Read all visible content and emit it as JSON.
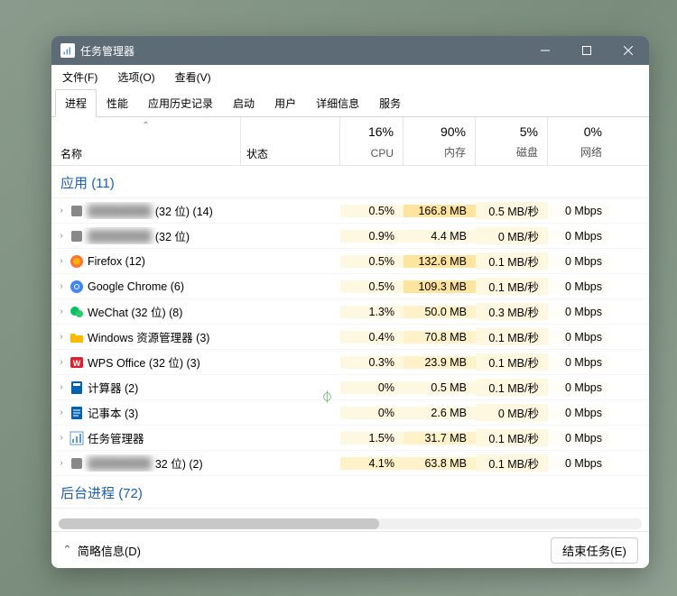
{
  "window": {
    "title": "任务管理器"
  },
  "menubar": {
    "file": "文件(F)",
    "options": "选项(O)",
    "view": "查看(V)"
  },
  "tabs": {
    "items": [
      {
        "label": "进程",
        "active": true
      },
      {
        "label": "性能",
        "active": false
      },
      {
        "label": "应用历史记录",
        "active": false
      },
      {
        "label": "启动",
        "active": false
      },
      {
        "label": "用户",
        "active": false
      },
      {
        "label": "详细信息",
        "active": false
      },
      {
        "label": "服务",
        "active": false
      }
    ]
  },
  "columns": {
    "name": "名称",
    "status": "状态",
    "cpu": {
      "pct": "16%",
      "label": "CPU"
    },
    "memory": {
      "pct": "90%",
      "label": "内存"
    },
    "disk": {
      "pct": "5%",
      "label": "磁盘"
    },
    "network": {
      "pct": "0%",
      "label": "网络"
    }
  },
  "groups": {
    "apps": {
      "label": "应用",
      "count_text": "(11)"
    },
    "bg": {
      "label": "后台进程",
      "count_text": "(72)"
    }
  },
  "rows": [
    {
      "name": "",
      "suffix": "(32 位) (14)",
      "blurred": true,
      "icon": "generic",
      "cpu": "0.5%",
      "mem": "166.8 MB",
      "disk": "0.5 MB/秒",
      "net": "0 Mbps",
      "mem_heat": 3
    },
    {
      "name": "",
      "suffix": "(32 位)",
      "blurred": true,
      "icon": "generic",
      "cpu": "0.9%",
      "mem": "4.4 MB",
      "disk": "0 MB/秒",
      "net": "0 Mbps",
      "mem_heat": 1
    },
    {
      "name": "Firefox (12)",
      "suffix": "",
      "blurred": false,
      "icon": "firefox",
      "cpu": "0.5%",
      "mem": "132.6 MB",
      "disk": "0.1 MB/秒",
      "net": "0 Mbps",
      "mem_heat": 3
    },
    {
      "name": "Google Chrome (6)",
      "suffix": "",
      "blurred": false,
      "icon": "chrome",
      "cpu": "0.5%",
      "mem": "109.3 MB",
      "disk": "0.1 MB/秒",
      "net": "0 Mbps",
      "mem_heat": 3
    },
    {
      "name": "WeChat (32 位) (8)",
      "suffix": "",
      "blurred": false,
      "icon": "wechat",
      "cpu": "1.3%",
      "mem": "50.0 MB",
      "disk": "0.3 MB/秒",
      "net": "0 Mbps",
      "mem_heat": 2
    },
    {
      "name": "Windows 资源管理器 (3)",
      "suffix": "",
      "blurred": false,
      "icon": "explorer",
      "cpu": "0.4%",
      "mem": "70.8 MB",
      "disk": "0.1 MB/秒",
      "net": "0 Mbps",
      "mem_heat": 2
    },
    {
      "name": "WPS Office (32 位) (3)",
      "suffix": "",
      "blurred": false,
      "icon": "wps",
      "cpu": "0.3%",
      "mem": "23.9 MB",
      "disk": "0.1 MB/秒",
      "net": "0 Mbps",
      "mem_heat": 2
    },
    {
      "name": "计算器 (2)",
      "suffix": "",
      "blurred": false,
      "icon": "calc",
      "status_icon": "leaf",
      "cpu": "0%",
      "mem": "0.5 MB",
      "disk": "0.1 MB/秒",
      "net": "0 Mbps",
      "mem_heat": 1
    },
    {
      "name": "记事本 (3)",
      "suffix": "",
      "blurred": false,
      "icon": "notepad",
      "cpu": "0%",
      "mem": "2.6 MB",
      "disk": "0 MB/秒",
      "net": "0 Mbps",
      "mem_heat": 1
    },
    {
      "name": "任务管理器",
      "suffix": "",
      "blurred": false,
      "icon": "taskmgr",
      "cpu": "1.5%",
      "mem": "31.7 MB",
      "disk": "0.1 MB/秒",
      "net": "0 Mbps",
      "mem_heat": 2
    },
    {
      "name": "",
      "suffix": "32 位) (2)",
      "blurred": true,
      "icon": "generic",
      "cpu": "4.1%",
      "mem": "63.8 MB",
      "disk": "0.1 MB/秒",
      "net": "0 Mbps",
      "mem_heat": 2,
      "cpu_heat": 2
    }
  ],
  "footer": {
    "fewer": "简略信息(D)",
    "end_task": "结束任务(E)"
  }
}
